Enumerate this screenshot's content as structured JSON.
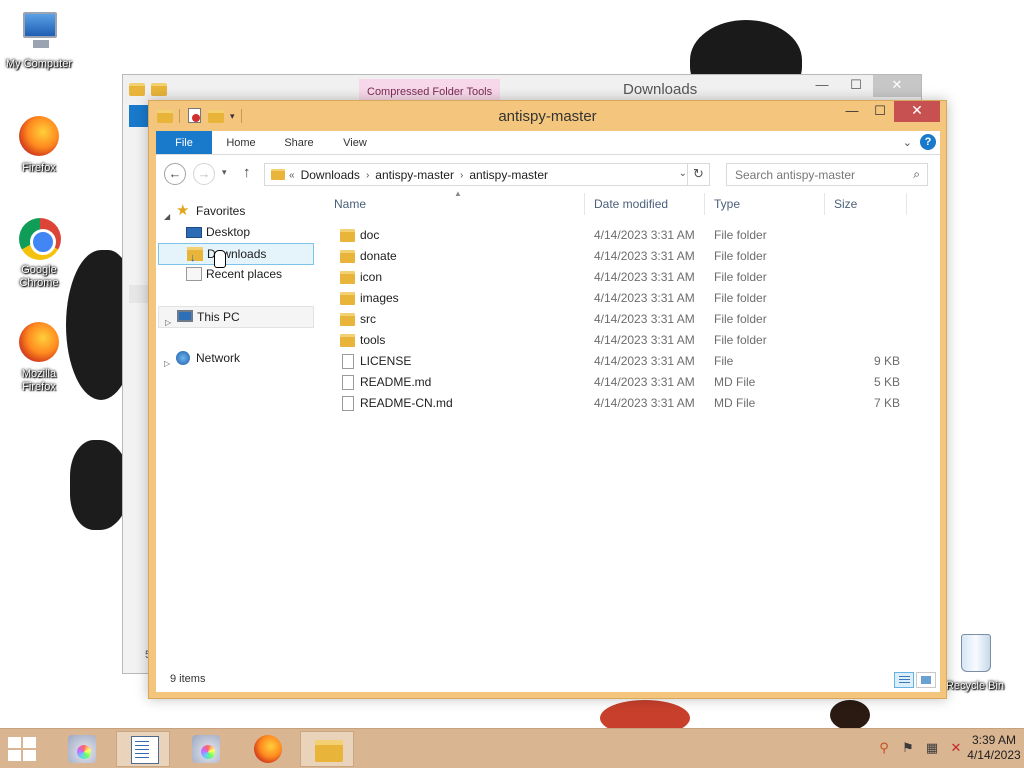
{
  "desktop": {
    "icons": [
      {
        "label": "My Computer",
        "icon": "computer-icon"
      },
      {
        "label": "Firefox",
        "icon": "firefox-icon"
      },
      {
        "label": "Google Chrome",
        "icon": "chrome-icon"
      },
      {
        "label": "Mozilla Firefox",
        "icon": "firefox-icon"
      },
      {
        "label": "Recycle Bin",
        "icon": "recycle-bin-icon"
      }
    ]
  },
  "background_window": {
    "title": "Downloads",
    "context_tab": "Compressed Folder Tools",
    "footer_fragment": "5",
    "controls": {
      "minimize": "—",
      "maximize": "☐",
      "close": "✕"
    }
  },
  "window": {
    "title": "antispy-master",
    "controls": {
      "minimize": "—",
      "maximize": "☐",
      "close": "✕"
    },
    "qat_dropdown": "▾",
    "ribbon": {
      "tabs": [
        "File",
        "Home",
        "Share",
        "View"
      ],
      "expand": "⌄",
      "help": "?"
    },
    "nav": {
      "back": "←",
      "forward": "→",
      "recent": "▾",
      "up": "↑",
      "breadcrumb_overflow": "«",
      "breadcrumb": [
        "Downloads",
        "antispy-master",
        "antispy-master"
      ],
      "crumb_separator": "›",
      "address_dropdown": "⌄",
      "refresh": "↻",
      "search_placeholder": "Search antispy-master",
      "search_icon": "⌕"
    },
    "navpane": {
      "favorites": "Favorites",
      "desktop": "Desktop",
      "downloads": "Downloads",
      "recent_places": "Recent places",
      "this_pc": "This PC",
      "network": "Network"
    },
    "columns": {
      "name": "Name",
      "date": "Date modified",
      "type": "Type",
      "size": "Size"
    },
    "files": [
      {
        "name": "doc",
        "date": "4/14/2023 3:31 AM",
        "type": "File folder",
        "size": "",
        "kind": "folder"
      },
      {
        "name": "donate",
        "date": "4/14/2023 3:31 AM",
        "type": "File folder",
        "size": "",
        "kind": "folder"
      },
      {
        "name": "icon",
        "date": "4/14/2023 3:31 AM",
        "type": "File folder",
        "size": "",
        "kind": "folder"
      },
      {
        "name": "images",
        "date": "4/14/2023 3:31 AM",
        "type": "File folder",
        "size": "",
        "kind": "folder"
      },
      {
        "name": "src",
        "date": "4/14/2023 3:31 AM",
        "type": "File folder",
        "size": "",
        "kind": "folder"
      },
      {
        "name": "tools",
        "date": "4/14/2023 3:31 AM",
        "type": "File folder",
        "size": "",
        "kind": "folder"
      },
      {
        "name": "LICENSE",
        "date": "4/14/2023 3:31 AM",
        "type": "File",
        "size": "9 KB",
        "kind": "file"
      },
      {
        "name": "README.md",
        "date": "4/14/2023 3:31 AM",
        "type": "MD File",
        "size": "5 KB",
        "kind": "file"
      },
      {
        "name": "README-CN.md",
        "date": "4/14/2023 3:31 AM",
        "type": "MD File",
        "size": "7 KB",
        "kind": "file"
      }
    ],
    "status": "9 items"
  },
  "taskbar": {
    "items": [
      "installer-icon",
      "notepad-icon",
      "installer-icon",
      "firefox-icon",
      "file-explorer-icon"
    ],
    "tray_icons": [
      "search-icon",
      "flag-icon",
      "network-icon",
      "volume-muted-icon"
    ],
    "tray_glyphs": [
      "⚲",
      "⚑",
      "▦",
      "✕"
    ],
    "time": "3:39 AM",
    "date": "4/14/2023"
  },
  "colors": {
    "window_frame": "#f4c67d",
    "close_button": "#c75050",
    "file_tab": "#1979ca",
    "selection": "#e5f3fb",
    "taskbar": "#d9b592",
    "compressed_tab": "#f7d8ea"
  }
}
